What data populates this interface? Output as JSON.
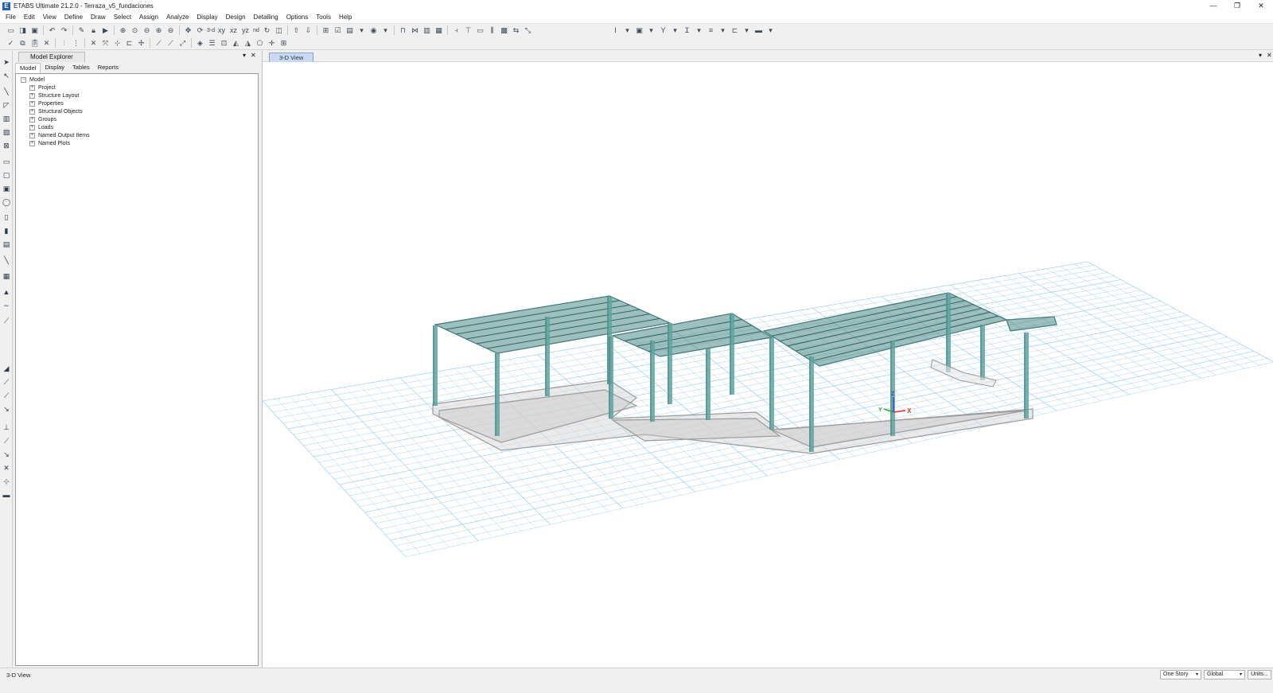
{
  "window": {
    "title": "ETABS Ultimate 21.2.0 - Terraza_v5_fundaciones",
    "app_icon": "E",
    "controls": [
      "—",
      "❐",
      "✕"
    ]
  },
  "menu": [
    "File",
    "Edit",
    "View",
    "Define",
    "Draw",
    "Select",
    "Assign",
    "Analyze",
    "Display",
    "Design",
    "Detailing",
    "Options",
    "Tools",
    "Help"
  ],
  "toolbar1": {
    "text_buttons": {
      "view3d": "3-d",
      "nd": "nd"
    }
  },
  "explorer": {
    "title": "Model Explorer",
    "pin": "▾",
    "close": "✕",
    "tabs": [
      "Model",
      "Display",
      "Tables",
      "Reports"
    ],
    "active_tab": "Model",
    "tree_root": "Model",
    "tree_items": [
      "Project",
      "Structure Layout",
      "Properties",
      "Structural Objects",
      "Groups",
      "Loads",
      "Named Output Items",
      "Named Plots"
    ]
  },
  "view": {
    "tab_label": "3-D View",
    "pin": "▾",
    "close": "✕",
    "axis_labels": {
      "x": "X",
      "y": "Y",
      "z": "Z"
    },
    "colors": {
      "frame": "#5fa3a0",
      "slab": "#4d8a86",
      "grid": "#a9d3ef",
      "foundation": "#9a9a9a",
      "axis_x": "#e0302a",
      "axis_y": "#2aa52a",
      "axis_z": "#2a52d0"
    }
  },
  "status": {
    "view_name": "3-D View",
    "story_select": "One Story",
    "coord_select": "Global",
    "units_button": "Units..."
  }
}
